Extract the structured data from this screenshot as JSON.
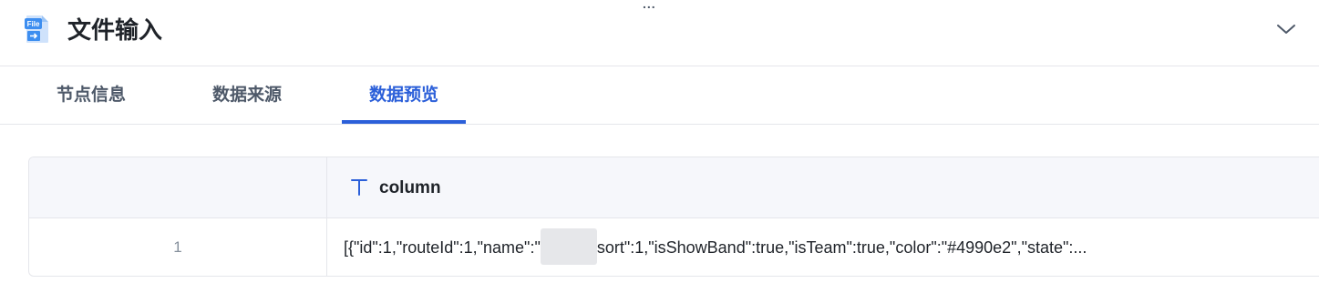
{
  "header": {
    "title": "文件输入",
    "file_icon_label": "File",
    "grip": "...",
    "collapse_icon": "chevron-down-icon"
  },
  "tabs": [
    {
      "label": "节点信息",
      "active": false
    },
    {
      "label": "数据来源",
      "active": false
    },
    {
      "label": "数据预览",
      "active": true
    }
  ],
  "table": {
    "column_type_icon": "text-type-icon",
    "columns": [
      "column"
    ],
    "rows": [
      {
        "index": "1",
        "value_before": "[{\"id\":1,\"routeId\":1,\"name\":\"",
        "value_after": "sort\":1,\"isShowBand\":true,\"isTeam\":true,\"color\":\"#4990e2\",\"state\":..."
      }
    ]
  },
  "colors": {
    "accent": "#2b5fd9",
    "border": "#e5e6eb",
    "header_bg": "#f6f7fb",
    "icon_blue": "#3d8ef0"
  }
}
